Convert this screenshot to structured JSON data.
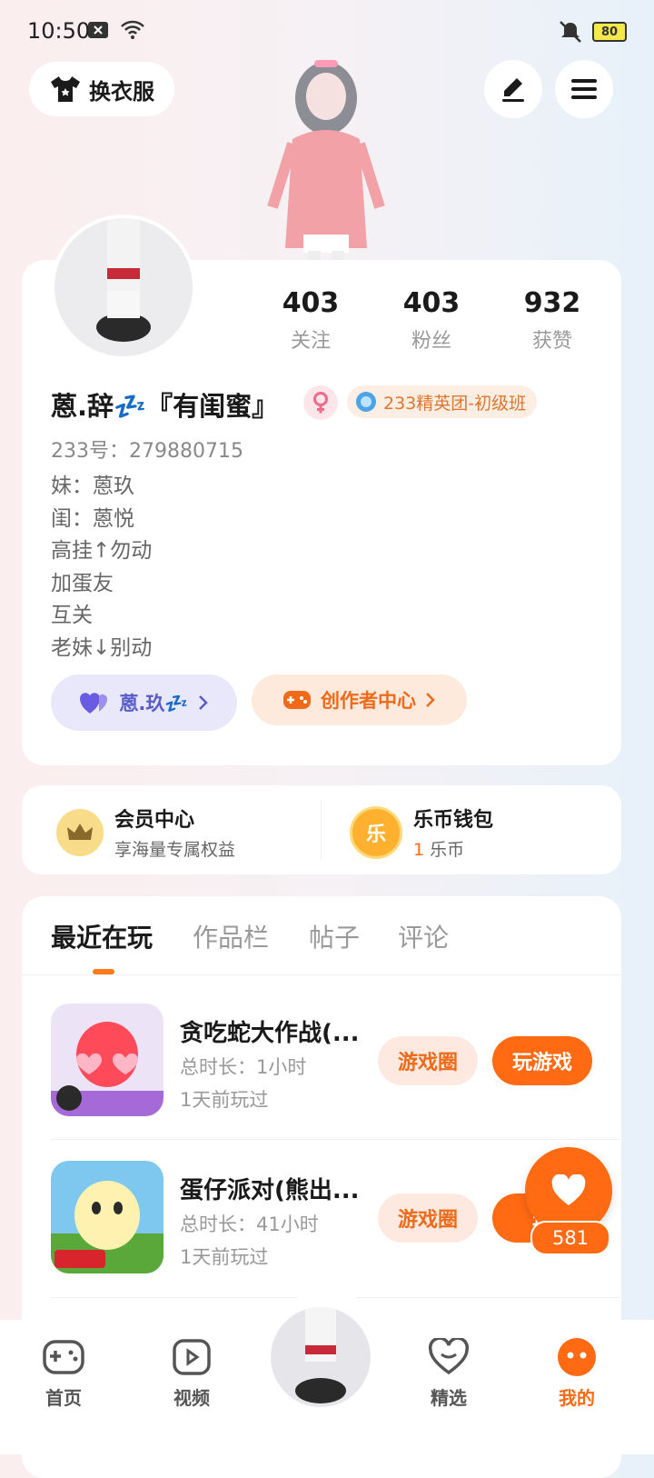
{
  "status_bar": {
    "time": "10:50",
    "battery": "80"
  },
  "top_bar": {
    "outfit_label": "换衣服"
  },
  "profile": {
    "stats": [
      {
        "value": "403",
        "label": "关注"
      },
      {
        "value": "403",
        "label": "粉丝"
      },
      {
        "value": "932",
        "label": "获赞"
      }
    ],
    "nickname": "蒽.辞💤『有闺蜜』",
    "rank_badge": "233精英团-初级班",
    "uid": "233号：279880715",
    "bio": [
      "妹：蒽玖",
      "闺：蒽悦",
      "高挂↑勿动",
      "加蛋友",
      "互关",
      "老妹↓别动"
    ],
    "friend_pill": "蒽.玖💤",
    "creator_pill": "创作者中心"
  },
  "member": {
    "vip_title": "会员中心",
    "vip_sub": "享海量专属权益",
    "wallet_title": "乐币钱包",
    "wallet_amount": "1",
    "wallet_unit": "乐币"
  },
  "tabs": [
    "最近在玩",
    "作品栏",
    "帖子",
    "评论"
  ],
  "games": [
    {
      "title": "贪吃蛇大作战(...",
      "duration": "总时长：1小时",
      "last_played": "1天前玩过",
      "circle_label": "游戏圈",
      "play_label": "玩游戏"
    },
    {
      "title": "蛋仔派对(熊出...",
      "duration": "总时长：41小时",
      "last_played": "1天前玩过",
      "circle_label": "游戏圈",
      "play_label": "玩"
    }
  ],
  "like_fab": {
    "count": "581"
  },
  "bottom_nav": [
    {
      "label": "首页"
    },
    {
      "label": "视频"
    },
    {
      "label": "精选"
    },
    {
      "label": "我的"
    }
  ],
  "colors": {
    "accent": "#ff6a13",
    "active_nav": "#ff6a13"
  }
}
